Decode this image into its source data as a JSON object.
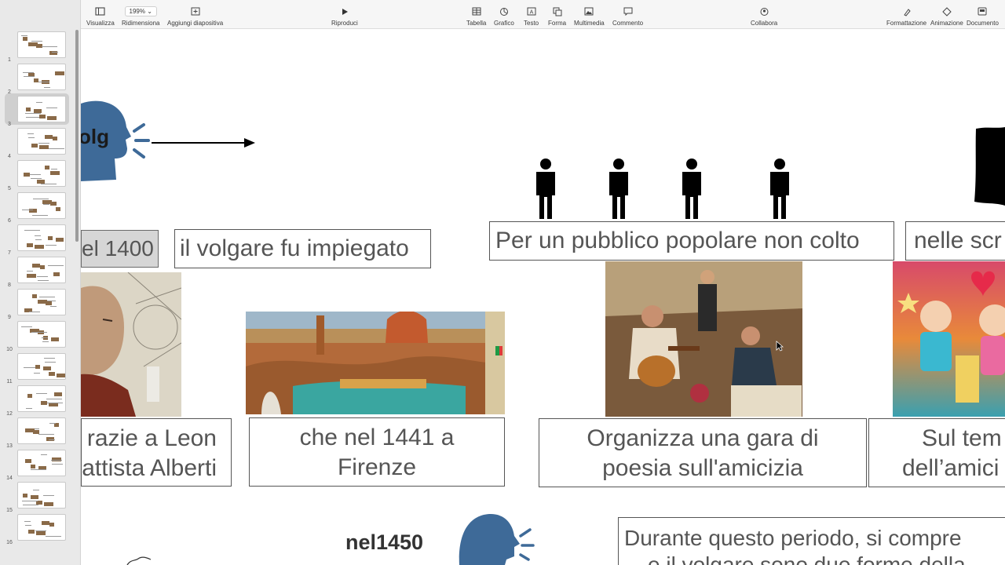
{
  "toolbar": {
    "view_label": "Visualizza",
    "zoom_value": "199%",
    "resize_label": "Ridimensiona",
    "add_slide_label": "Aggiungi diapositiva",
    "play_label": "Riproduci",
    "table_label": "Tabella",
    "chart_label": "Grafico",
    "text_label": "Testo",
    "shape_label": "Forma",
    "media_label": "Multimedia",
    "comment_label": "Commento",
    "collaborate_label": "Collabora",
    "format_label": "Formattazione",
    "animate_label": "Animazione",
    "document_label": "Documento"
  },
  "sidebar": {
    "selected_slide": 3,
    "slides": [
      "1",
      "2",
      "3",
      "4",
      "5",
      "6",
      "7",
      "8",
      "9",
      "10",
      "11",
      "12",
      "13",
      "14",
      "15",
      "16"
    ]
  },
  "slide": {
    "volg_label": "olg",
    "year_1400": "el 1400",
    "volgare_text": "il volgare fu impiegato",
    "pubblico_text": "Per un pubblico popolare non colto",
    "nelle_text": "nelle scr",
    "grazie_line1": "razie a Leon",
    "grazie_line2": "attista Alberti",
    "firenze_line1": "che nel 1441 a",
    "firenze_line2": "Firenze",
    "gara_line1": "Organizza una gara di",
    "gara_line2": "poesia sull'amicizia",
    "tema_line1": "Sul tem",
    "tema_line2": "dell’amici",
    "nel1450": "nel1450",
    "durante_line1": "Durante questo periodo, si compre",
    "durante_line2": "e il volgare sono due forme della"
  },
  "colors": {
    "head_blue": "#3e6a98",
    "sidebar_bg": "#e9e9e9",
    "toolbar_bg": "#f6f6f6",
    "box_text": "#555555",
    "highlight_box": "#d6d6d6"
  }
}
